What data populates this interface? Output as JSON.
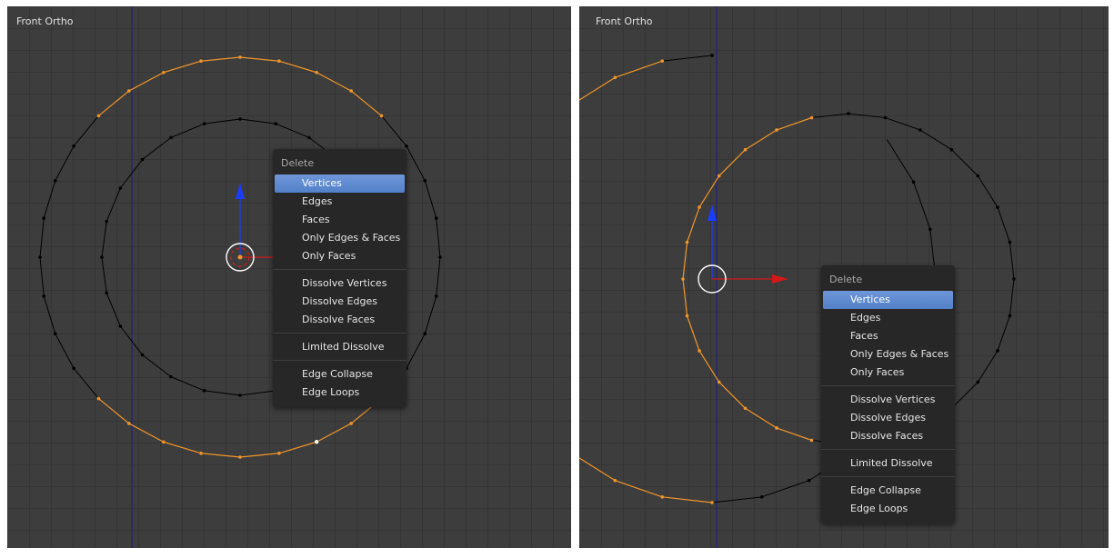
{
  "left_viewport": {
    "label": "Front Ortho",
    "menu": {
      "title": "Delete",
      "groups": [
        [
          "Vertices",
          "Edges",
          "Faces",
          "Only Edges & Faces",
          "Only Faces"
        ],
        [
          "Dissolve Vertices",
          "Dissolve Edges",
          "Dissolve Faces"
        ],
        [
          "Limited Dissolve"
        ],
        [
          "Edge Collapse",
          "Edge Loops"
        ]
      ],
      "highlighted": "Vertices"
    }
  },
  "right_viewport": {
    "label": "Front Ortho",
    "menu": {
      "title": "Delete",
      "groups": [
        [
          "Vertices",
          "Edges",
          "Faces",
          "Only Edges & Faces",
          "Only Faces"
        ],
        [
          "Dissolve Vertices",
          "Dissolve Edges",
          "Dissolve Faces"
        ],
        [
          "Limited Dissolve"
        ],
        [
          "Edge Collapse",
          "Edge Loops"
        ]
      ],
      "highlighted": "Vertices"
    }
  },
  "colors": {
    "viewport_bg": "#3d3d3d",
    "edge": "#000000",
    "selected": "#f0962a",
    "active_vertex": "#ffffff",
    "y_axis_line": "#1a1a8c",
    "gizmo_z": "#1a3cff",
    "gizmo_x": "#d21818",
    "menu_bg": "#272727",
    "menu_highlight": "#5a86cf"
  }
}
